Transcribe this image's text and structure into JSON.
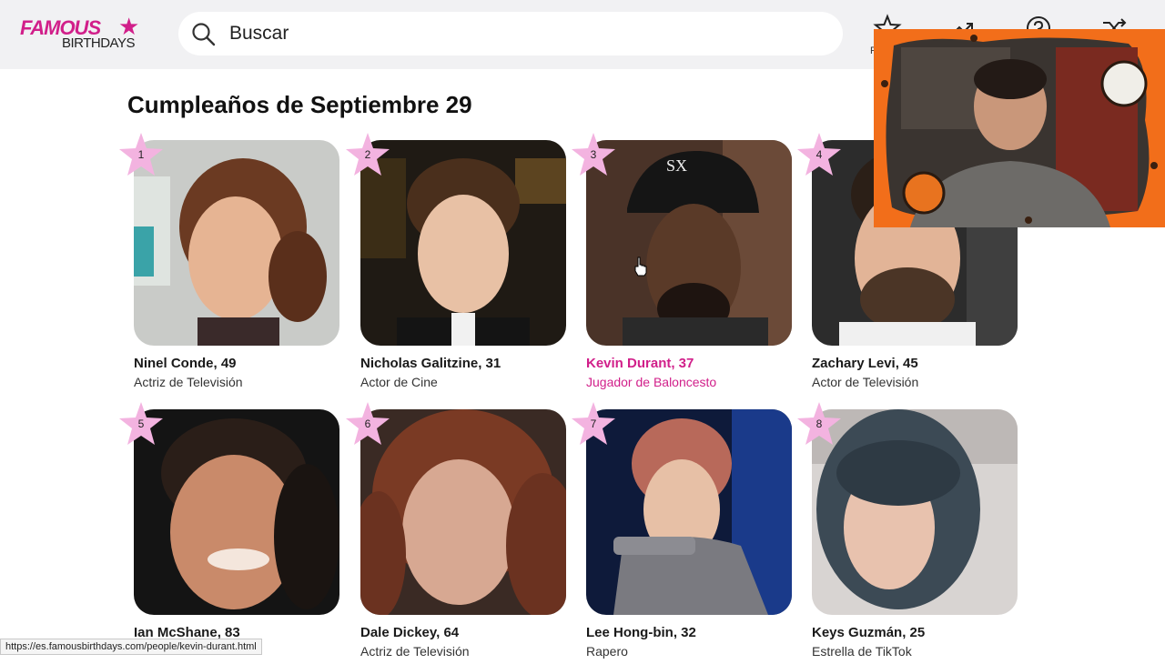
{
  "logo": {
    "top": "FAMOUS",
    "bottom": "BIRTHDAYS"
  },
  "search": {
    "placeholder": "Buscar"
  },
  "nav": {
    "first_label": "P"
  },
  "heading": "Cumpleaños de Septiembre 29",
  "accent_color": "#d11f8a",
  "cards": [
    {
      "rank": "1",
      "name": "Ninel Conde, 49",
      "job": "Actriz de Televisión"
    },
    {
      "rank": "2",
      "name": "Nicholas Galitzine, 31",
      "job": "Actor de Cine"
    },
    {
      "rank": "3",
      "name": "Kevin Durant, 37",
      "job": "Jugador de Baloncesto"
    },
    {
      "rank": "4",
      "name": "Zachary Levi, 45",
      "job": "Actor de Televisión"
    },
    {
      "rank": "5",
      "name": "Ian McShane, 83",
      "job": ""
    },
    {
      "rank": "6",
      "name": "Dale Dickey, 64",
      "job": "Actriz de Televisión"
    },
    {
      "rank": "7",
      "name": "Lee Hong-bin, 32",
      "job": "Rapero"
    },
    {
      "rank": "8",
      "name": "Keys Guzmán, 25",
      "job": "Estrella de TikTok"
    }
  ],
  "status_url": "https://es.famousbirthdays.com/people/kevin-durant.html"
}
